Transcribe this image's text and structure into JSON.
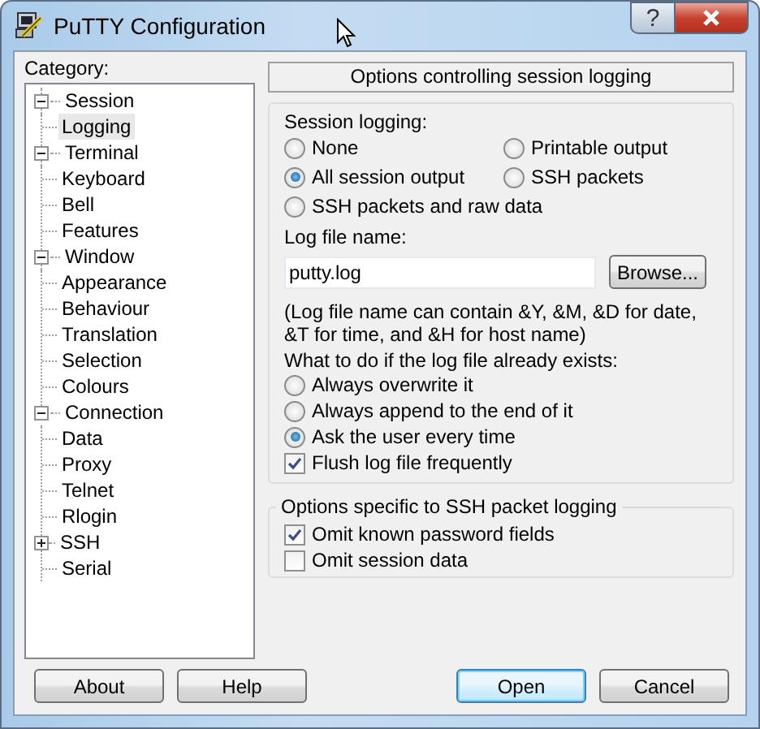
{
  "window": {
    "title": "PuTTY Configuration",
    "help": "?"
  },
  "category": {
    "label": "Category:",
    "tree": [
      {
        "label": "Session",
        "expanded": true,
        "selected": false,
        "children": [
          {
            "label": "Logging",
            "selected": true
          }
        ]
      },
      {
        "label": "Terminal",
        "expanded": true,
        "selected": false,
        "children": [
          {
            "label": "Keyboard",
            "selected": false
          },
          {
            "label": "Bell",
            "selected": false
          },
          {
            "label": "Features",
            "selected": false
          }
        ]
      },
      {
        "label": "Window",
        "expanded": true,
        "selected": false,
        "children": [
          {
            "label": "Appearance",
            "selected": false
          },
          {
            "label": "Behaviour",
            "selected": false
          },
          {
            "label": "Translation",
            "selected": false
          },
          {
            "label": "Selection",
            "selected": false
          },
          {
            "label": "Colours",
            "selected": false
          }
        ]
      },
      {
        "label": "Connection",
        "expanded": true,
        "selected": false,
        "children": [
          {
            "label": "Data",
            "selected": false
          },
          {
            "label": "Proxy",
            "selected": false
          },
          {
            "label": "Telnet",
            "selected": false
          },
          {
            "label": "Rlogin",
            "selected": false
          },
          {
            "label": "SSH",
            "expanded": false,
            "selected": false
          },
          {
            "label": "Serial",
            "selected": false
          }
        ]
      }
    ]
  },
  "panel": {
    "header": "Options controlling session logging",
    "session_logging": {
      "label": "Session logging:",
      "options": [
        {
          "label": "None",
          "selected": false
        },
        {
          "label": "Printable output",
          "selected": false
        },
        {
          "label": "All session output",
          "selected": true
        },
        {
          "label": "SSH packets",
          "selected": false
        },
        {
          "label": "SSH packets and raw data",
          "selected": false
        }
      ]
    },
    "log_file": {
      "label": "Log file name:",
      "value": "putty.log",
      "browse": "Browse...",
      "hint": "(Log file name can contain &Y, &M, &D for date, &T for time, and &H for host name)"
    },
    "exists": {
      "label": "What to do if the log file already exists:",
      "options": [
        {
          "label": "Always overwrite it",
          "selected": false
        },
        {
          "label": "Always append to the end of it",
          "selected": false
        },
        {
          "label": "Ask the user every time",
          "selected": true
        }
      ]
    },
    "flush": {
      "label": "Flush log file frequently",
      "checked": true
    },
    "ssh_group": {
      "title": "Options specific to SSH packet logging",
      "options": [
        {
          "label": "Omit known password fields",
          "checked": true
        },
        {
          "label": "Omit session data",
          "checked": false
        }
      ]
    }
  },
  "buttons": [
    {
      "label": "About",
      "default": false
    },
    {
      "label": "Help",
      "default": false
    },
    {
      "label": "Open",
      "default": true
    },
    {
      "label": "Cancel",
      "default": false
    }
  ]
}
